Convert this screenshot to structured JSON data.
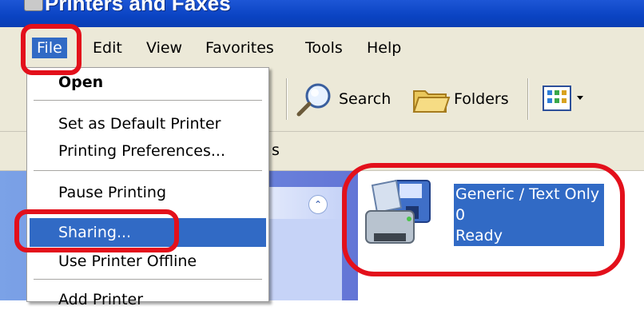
{
  "window": {
    "title": "Printers and Faxes"
  },
  "menubar": {
    "items": [
      "File",
      "Edit",
      "View",
      "Favorites",
      "Tools",
      "Help"
    ],
    "active": "File"
  },
  "toolbar": {
    "search_label": "Search",
    "folders_label": "Folders"
  },
  "address": {
    "partial_text": "s"
  },
  "file_menu": {
    "items": [
      {
        "label": "Open",
        "bold": true
      },
      {
        "label": "Set as Default Printer"
      },
      {
        "label": "Printing Preferences..."
      },
      {
        "label": "Pause Printing"
      },
      {
        "label": "Sharing...",
        "highlighted": true
      },
      {
        "label": "Use Printer Offline"
      },
      {
        "label": "Add Printer"
      }
    ]
  },
  "printer": {
    "name": "Generic / Text Only",
    "jobs": "0",
    "status": "Ready"
  },
  "colors": {
    "highlight": "#316ac5",
    "annotation": "#e3101b",
    "titlebar": "#0a43c2",
    "menubar": "#ece9d8"
  }
}
